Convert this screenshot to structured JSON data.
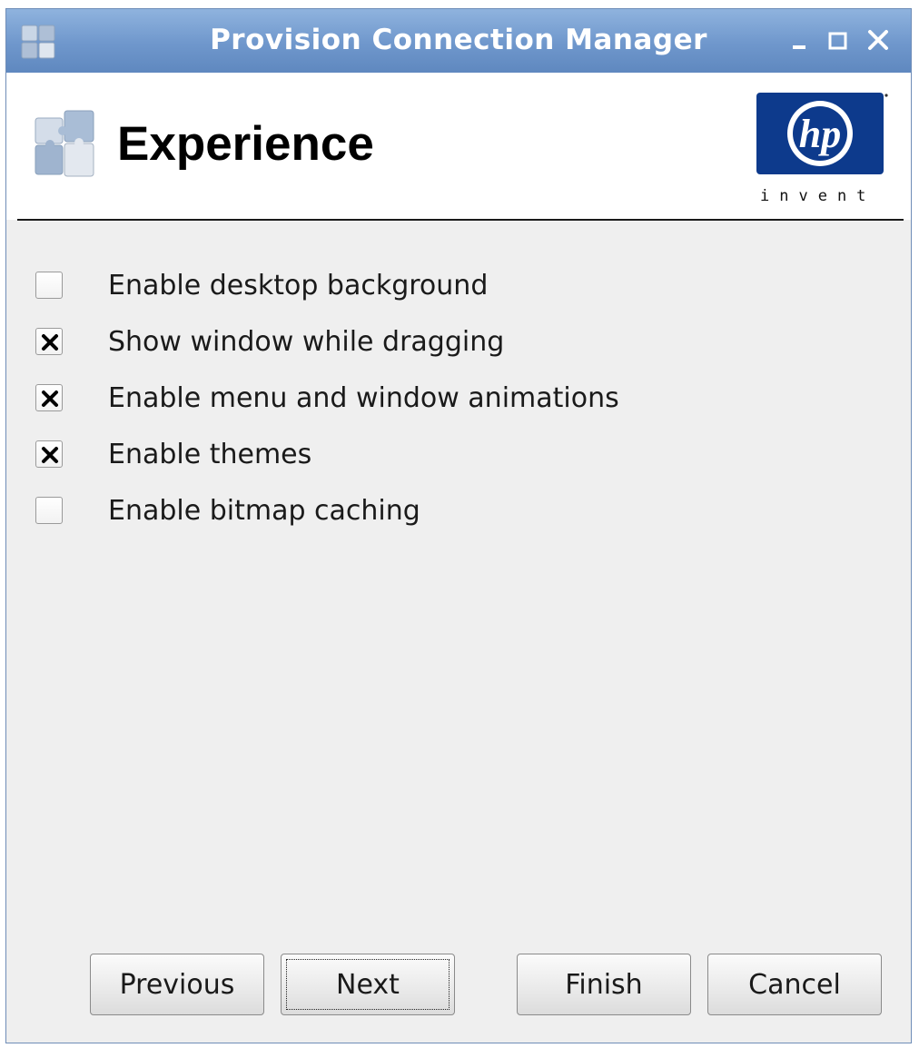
{
  "window": {
    "title": "Provision Connection Manager",
    "controls": [
      "minimize-icon",
      "maximize-icon",
      "close-icon"
    ]
  },
  "header": {
    "title": "Experience",
    "icon": "puzzle-icon",
    "logo_mark": "hp",
    "logo_tagline": "invent"
  },
  "options": [
    {
      "label": "Enable desktop background",
      "checked": false
    },
    {
      "label": "Show window while dragging",
      "checked": true
    },
    {
      "label": "Enable menu and window animations",
      "checked": true
    },
    {
      "label": "Enable themes",
      "checked": true
    },
    {
      "label": "Enable bitmap caching",
      "checked": false
    }
  ],
  "buttons": {
    "previous": "Previous",
    "next": "Next",
    "finish": "Finish",
    "cancel": "Cancel"
  },
  "colors": {
    "titlebar": "#6f97cc",
    "hp_blue": "#0d3a8c",
    "panel": "#efefef"
  }
}
